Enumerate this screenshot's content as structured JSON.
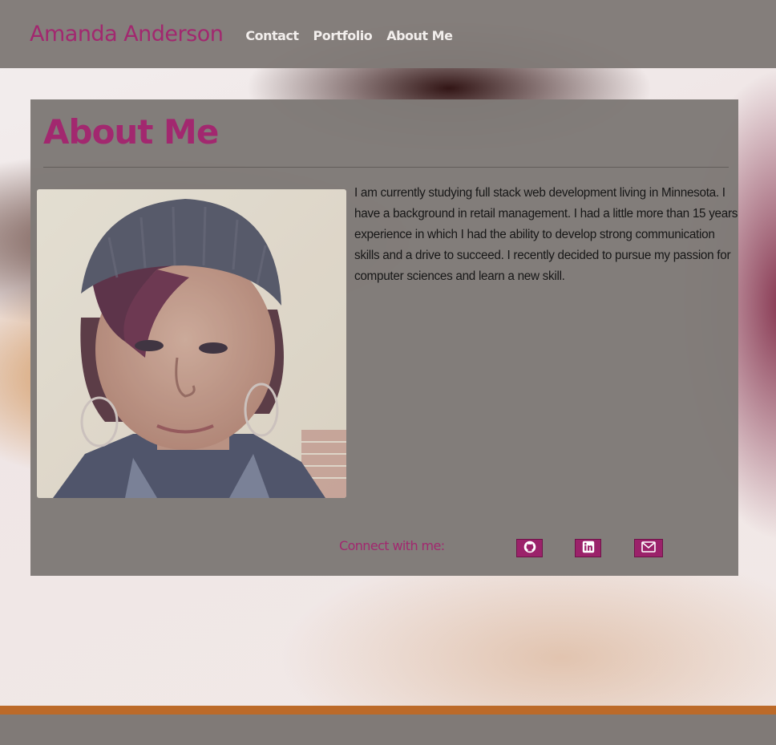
{
  "site": {
    "brand": "Amanda Anderson"
  },
  "nav": {
    "links": [
      {
        "label": "Contact"
      },
      {
        "label": "Portfolio"
      },
      {
        "label": "About Me"
      }
    ]
  },
  "about": {
    "title": "About Me",
    "bio": "I am currently studying full stack web development living in Minnesota. I have a background in retail management. I had a little more than 15 years experience in which I had the ability to develop strong communication skills and a drive to succeed. I recently decided to pursue my passion for computer sciences and learn a new skill.",
    "connect_label": "Connect with me:",
    "social": [
      {
        "icon": "github-icon"
      },
      {
        "icon": "linkedin-icon"
      },
      {
        "icon": "envelope-icon"
      }
    ]
  },
  "colors": {
    "accent": "#a2286f",
    "nav_bg": "#807a77",
    "footer_stripe": "#bc6a29"
  }
}
